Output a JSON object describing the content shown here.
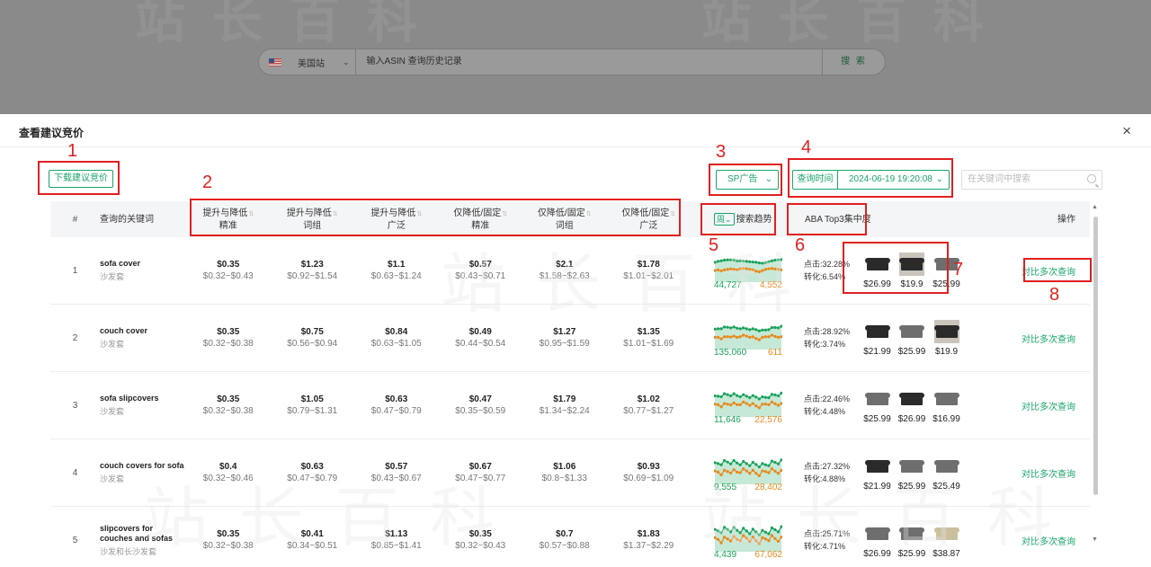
{
  "background": {
    "site_label": "美国站",
    "search_placeholder": "输入ASIN 查询历史记录",
    "search_button": "搜 索"
  },
  "modal": {
    "title": "查看建议竞价",
    "close": "×",
    "download_button": "下载建议竞价",
    "ad_type": "SP广告",
    "time_label": "查询时间",
    "time_value": "2024-06-19 19:20:08",
    "keyword_search_placeholder": "在关键词中搜索"
  },
  "table": {
    "headers": {
      "index": "#",
      "keyword": "查询的关键词",
      "bid1": [
        "提升与降低",
        "精准"
      ],
      "bid2": [
        "提升与降低",
        "词组"
      ],
      "bid3": [
        "提升与降低",
        "广泛"
      ],
      "bid4": [
        "仅降低/固定",
        "精准"
      ],
      "bid5": [
        "仅降低/固定",
        "词组"
      ],
      "bid6": [
        "仅降低/固定",
        "广泛"
      ],
      "trend_select": "周",
      "trend": "搜索趋势",
      "aba": "ABA Top3集中度",
      "operation": "操作"
    },
    "rows": [
      {
        "index": "1",
        "keyword": "sofa cover",
        "sub": "沙发套",
        "bids": [
          [
            "$0.35",
            "$0.32~$0.43"
          ],
          [
            "$1.23",
            "$0.92~$1.54"
          ],
          [
            "$1.1",
            "$0.63~$1.24"
          ],
          [
            "$0.57",
            "$0.43~$0.71"
          ],
          [
            "$2.1",
            "$1.58~$2.63"
          ],
          [
            "$1.78",
            "$1.01~$2.01"
          ]
        ],
        "trend_left": "44,727",
        "trend_right": "4,552",
        "click": "点击:32.28%",
        "conv": "转化:6.54%",
        "prices": [
          "$26.99",
          "$19.9",
          "$25.99"
        ],
        "op": "对比多次查询"
      },
      {
        "index": "2",
        "keyword": "couch cover",
        "sub": "沙发套",
        "bids": [
          [
            "$0.35",
            "$0.32~$0.38"
          ],
          [
            "$0.75",
            "$0.56~$0.94"
          ],
          [
            "$0.84",
            "$0.63~$1.05"
          ],
          [
            "$0.49",
            "$0.44~$0.54"
          ],
          [
            "$1.27",
            "$0.95~$1.59"
          ],
          [
            "$1.35",
            "$1.01~$1.69"
          ]
        ],
        "trend_left": "135,060",
        "trend_right": "611",
        "click": "点击:28.92%",
        "conv": "转化:3.74%",
        "prices": [
          "$21.99",
          "$25.99",
          "$19.9"
        ],
        "op": "对比多次查询"
      },
      {
        "index": "3",
        "keyword": "sofa slipcovers",
        "sub": "沙发套",
        "bids": [
          [
            "$0.35",
            "$0.32~$0.38"
          ],
          [
            "$1.05",
            "$0.79~$1.31"
          ],
          [
            "$0.63",
            "$0.47~$0.79"
          ],
          [
            "$0.47",
            "$0.35~$0.59"
          ],
          [
            "$1.79",
            "$1.34~$2.24"
          ],
          [
            "$1.02",
            "$0.77~$1.27"
          ]
        ],
        "trend_left": "11,646",
        "trend_right": "22,576",
        "click": "点击:22.46%",
        "conv": "转化:4.48%",
        "prices": [
          "$25.99",
          "$26.99",
          "$16.99"
        ],
        "op": "对比多次查询"
      },
      {
        "index": "4",
        "keyword": "couch covers for sofa",
        "sub": "沙发套",
        "bids": [
          [
            "$0.4",
            "$0.32~$0.46"
          ],
          [
            "$0.63",
            "$0.47~$0.79"
          ],
          [
            "$0.57",
            "$0.43~$0.67"
          ],
          [
            "$0.67",
            "$0.47~$0.77"
          ],
          [
            "$1.06",
            "$0.8~$1.33"
          ],
          [
            "$0.93",
            "$0.69~$1.09"
          ]
        ],
        "trend_left": "9,555",
        "trend_right": "28,402",
        "click": "点击:27.32%",
        "conv": "转化:4.88%",
        "prices": [
          "$21.99",
          "$25.99",
          "$25.49"
        ],
        "op": "对比多次查询"
      },
      {
        "index": "5",
        "keyword": "slipcovers for couches and sofas",
        "sub": "沙发和长沙发套",
        "bids": [
          [
            "$0.35",
            "$0.32~$0.38"
          ],
          [
            "$0.41",
            "$0.34~$0.51"
          ],
          [
            "$1.13",
            "$0.85~$1.41"
          ],
          [
            "$0.35",
            "$0.32~$0.43"
          ],
          [
            "$0.7",
            "$0.57~$0.88"
          ],
          [
            "$1.83",
            "$1.37~$2.29"
          ]
        ],
        "trend_left": "4,439",
        "trend_right": "67,062",
        "click": "点击:25.71%",
        "conv": "转化:4.71%",
        "prices": [
          "$26.99",
          "$25.99",
          "$38.87"
        ],
        "op": "对比多次查询"
      }
    ]
  },
  "annotations": [
    "1",
    "2",
    "3",
    "4",
    "5",
    "6",
    "7",
    "8"
  ],
  "colors": {
    "accent": "#19a56a",
    "annotation": "#e02020",
    "trend_green": "#1aa35b",
    "trend_orange": "#e8891b"
  }
}
